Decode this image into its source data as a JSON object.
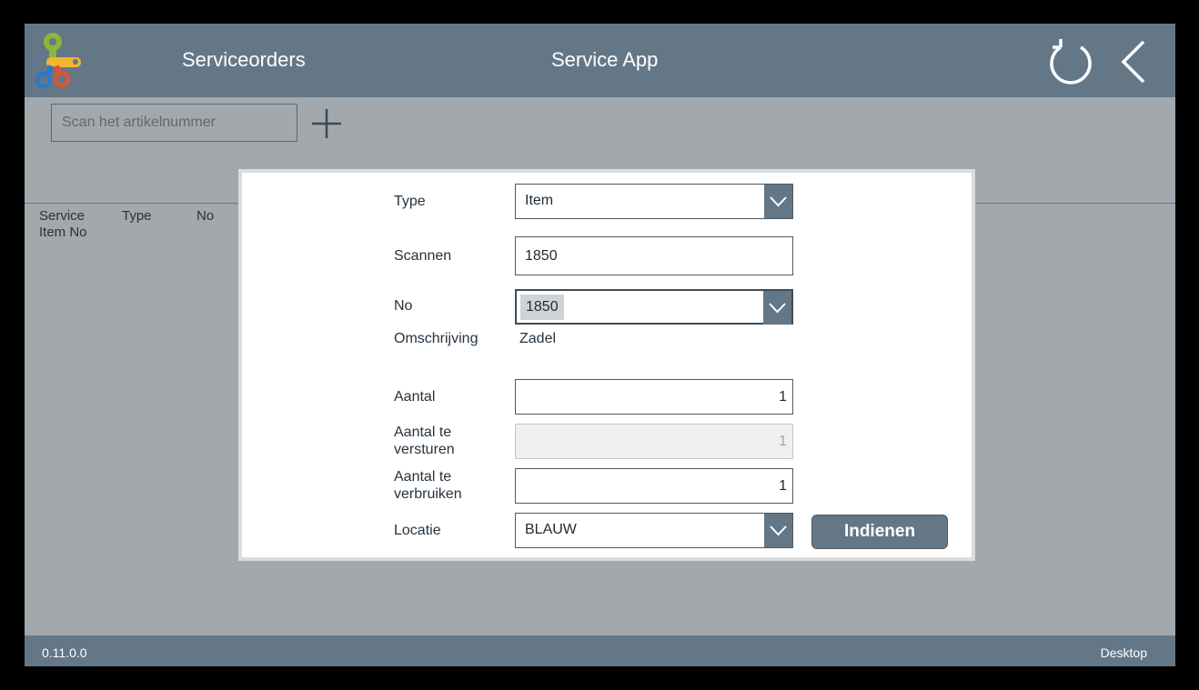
{
  "header": {
    "section_title": "Serviceorders",
    "app_title": "Service App"
  },
  "scan": {
    "placeholder": "Scan het artikelnummer"
  },
  "table": {
    "columns": [
      "Service Item No",
      "Type",
      "No"
    ]
  },
  "dialog": {
    "type_label": "Type",
    "type_value": "Item",
    "scan_label": "Scannen",
    "scan_value": "1850",
    "no_label": "No",
    "no_value": "1850",
    "desc_label": "Omschrijving",
    "desc_value": "Zadel",
    "qty_label": "Aantal",
    "qty_value": "1",
    "ship_label": "Aantal te versturen",
    "ship_value": "1",
    "use_label": "Aantal te verbruiken",
    "use_value": "1",
    "loc_label": "Locatie",
    "loc_value": "BLAUW",
    "submit_label": "Indienen"
  },
  "footer": {
    "version": "0.11.0.0",
    "mode": "Desktop"
  },
  "colors": {
    "header": "#647787",
    "background": "#a3a8ac"
  }
}
